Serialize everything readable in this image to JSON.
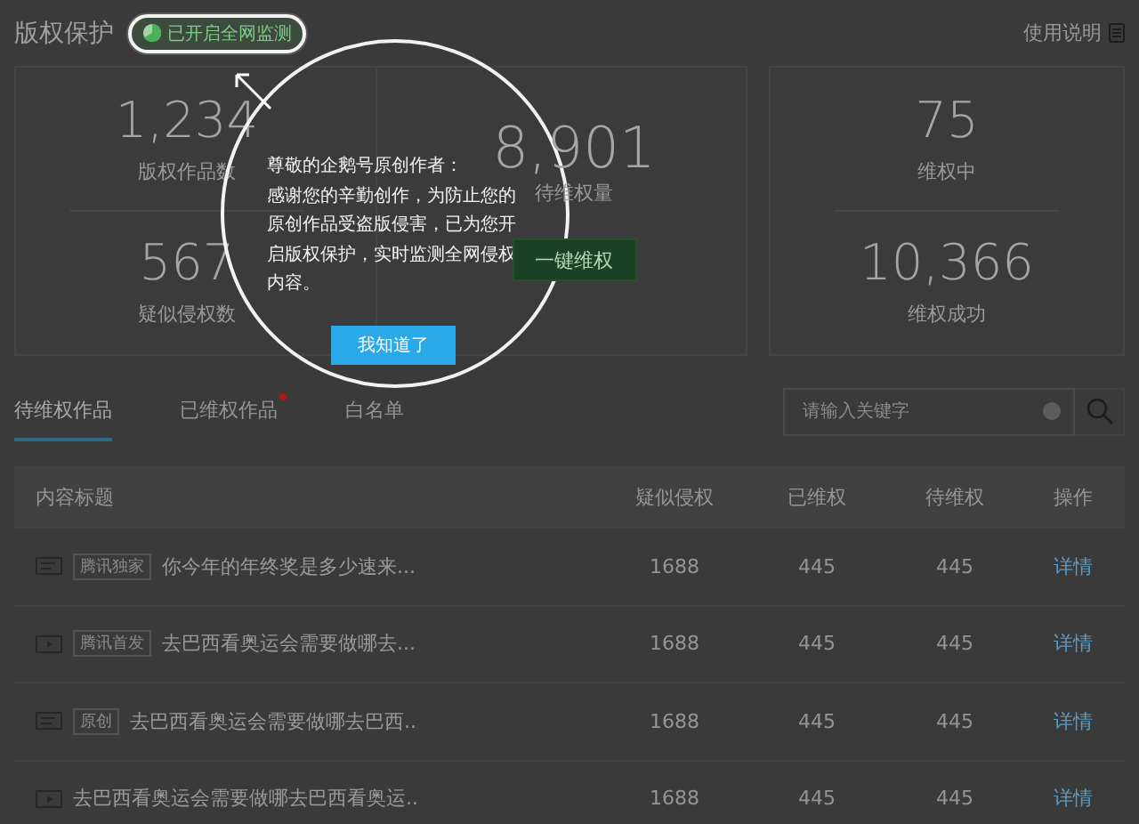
{
  "header": {
    "title": "版权保护",
    "badge": "已开启全网监测",
    "help_link": "使用说明"
  },
  "stats": {
    "left": [
      {
        "value": "1,234",
        "label": "版权作品数"
      },
      {
        "value": "567",
        "label": "疑似侵权数"
      }
    ],
    "pending": {
      "value": "8,901",
      "label": "待维权量",
      "button": "一键维权"
    },
    "right": [
      {
        "value": "75",
        "label": "维权中"
      },
      {
        "value": "10,366",
        "label": "维权成功"
      }
    ]
  },
  "tabs": [
    {
      "label": "待维权作品",
      "selected": true,
      "unread": false
    },
    {
      "label": "已维权作品",
      "selected": false,
      "unread": true
    },
    {
      "label": "白名单",
      "selected": false,
      "unread": false
    }
  ],
  "search": {
    "placeholder": "请输入关键字"
  },
  "table": {
    "columns": [
      "内容标题",
      "疑似侵权",
      "已维权",
      "待维权",
      "操作"
    ],
    "rows": [
      {
        "kind": "article",
        "tag": "腾讯独家",
        "title": "你今年的年终奖是多少速来...",
        "suspected": "1688",
        "defended": "445",
        "pending": "445",
        "action": "详情"
      },
      {
        "kind": "video",
        "tag": "腾讯首发",
        "title": "去巴西看奥运会需要做哪去...",
        "suspected": "1688",
        "defended": "445",
        "pending": "445",
        "action": "详情"
      },
      {
        "kind": "article",
        "tag": "原创",
        "title": "去巴西看奥运会需要做哪去巴西..",
        "suspected": "1688",
        "defended": "445",
        "pending": "445",
        "action": "详情"
      },
      {
        "kind": "video",
        "title": "去巴西看奥运会需要做哪去巴西看奥运..",
        "suspected": "1688",
        "defended": "445",
        "pending": "445",
        "action": "详情"
      }
    ]
  },
  "popup": {
    "greeting": "尊敬的企鹅号原创作者：",
    "message": "感谢您的辛勤创作，为防止您的原创作品受盗版侵害，已为您开启版权保护，实时监测全网侵权内容。",
    "button": "我知道了"
  }
}
